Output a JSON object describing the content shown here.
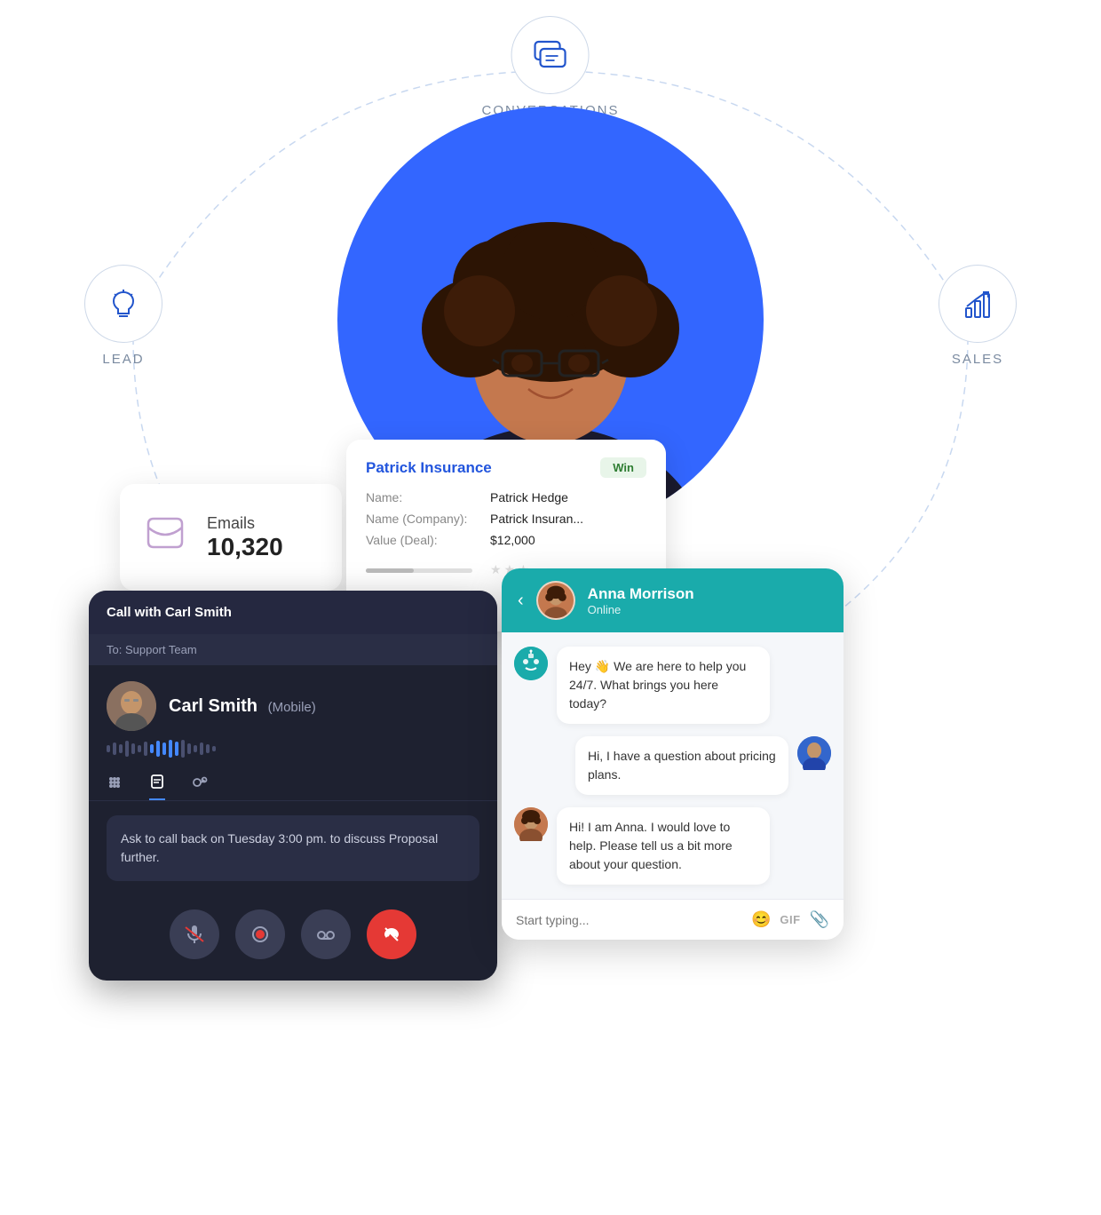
{
  "top_icon": {
    "label": "CONVERSATIONS",
    "icon": "💬"
  },
  "left_icon": {
    "label": "LEAD",
    "icon": "🧲"
  },
  "right_icon": {
    "label": "SALES",
    "icon": "📈"
  },
  "emails_card": {
    "label": "Emails",
    "count": "10,320"
  },
  "insurance_card": {
    "title": "Patrick Insurance",
    "badge": "Win",
    "fields": [
      {
        "label": "Name:",
        "value": "Patrick Hedge"
      },
      {
        "label": "Name (Company):",
        "value": "Patrick Insuran..."
      },
      {
        "label": "Value (Deal):",
        "value": "$12,000"
      }
    ]
  },
  "call_card": {
    "header": "Call with Carl Smith",
    "to": "To: Support Team",
    "person": {
      "name": "Carl Smith",
      "subtitle": "(Mobile)"
    },
    "note": "Ask to call back on Tuesday 3:00 pm. to discuss Proposal further.",
    "tabs": [
      {
        "label": "keypad",
        "active": false
      },
      {
        "label": "notes",
        "active": true
      },
      {
        "label": "transfer",
        "active": false
      }
    ],
    "controls": [
      {
        "id": "mute",
        "label": "🎤"
      },
      {
        "id": "record",
        "label": "⏺"
      },
      {
        "id": "voicemail",
        "label": "📞"
      },
      {
        "id": "end",
        "label": "📵"
      }
    ]
  },
  "chat_card": {
    "header": {
      "name": "Anna Morrison",
      "status": "Online"
    },
    "messages": [
      {
        "sender": "bot",
        "text": "Hey 👋 We are here to help you 24/7. What brings you here today?",
        "side": "left"
      },
      {
        "sender": "user",
        "text": "Hi, I have a question about pricing plans.",
        "side": "right"
      },
      {
        "sender": "anna",
        "text": "Hi! I am Anna. I would love to help. Please tell us a bit more about your question.",
        "side": "left"
      }
    ],
    "input_placeholder": "Start typing...",
    "input_icons": [
      "😊",
      "GIF",
      "📎"
    ]
  }
}
